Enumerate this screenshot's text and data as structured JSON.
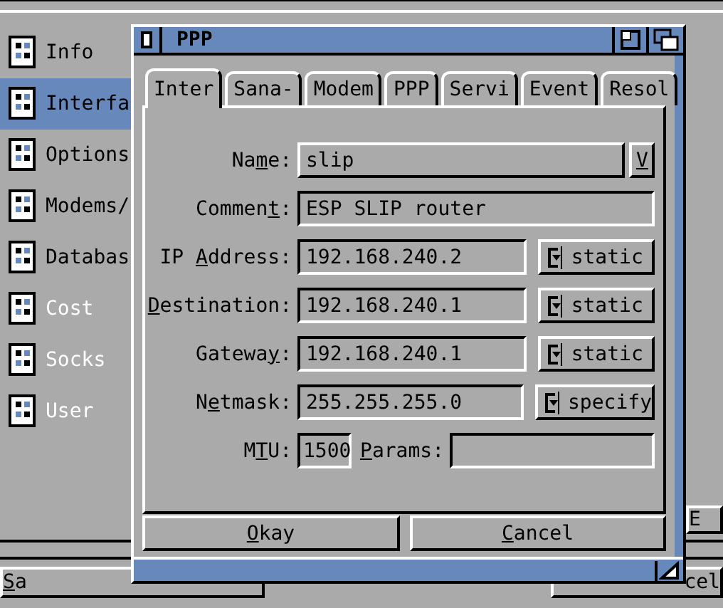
{
  "background": {
    "sidebar": [
      {
        "label": "Info",
        "selected": false,
        "disabled": false
      },
      {
        "label": "Interfa",
        "selected": true,
        "disabled": false
      },
      {
        "label": "Options",
        "selected": false,
        "disabled": false
      },
      {
        "label": "Modems/",
        "selected": false,
        "disabled": false
      },
      {
        "label": "Databas",
        "selected": false,
        "disabled": false
      },
      {
        "label": "Cost",
        "selected": false,
        "disabled": true
      },
      {
        "label": "Socks",
        "selected": false,
        "disabled": true
      },
      {
        "label": "User",
        "selected": false,
        "disabled": true
      }
    ],
    "side_button": "E",
    "save_button": {
      "key": "S",
      "post": "a"
    },
    "cancel_button": {
      "pre": "cel"
    }
  },
  "dialog": {
    "title": "PPP",
    "tabs": [
      {
        "label": "Inter",
        "selected": true
      },
      {
        "label": "Sana-",
        "selected": false
      },
      {
        "label": "Modem",
        "selected": false
      },
      {
        "label": "PPP",
        "selected": false
      },
      {
        "label": "Servi",
        "selected": false
      },
      {
        "label": "Event",
        "selected": false
      },
      {
        "label": "Resol",
        "selected": false
      }
    ],
    "rows": [
      {
        "kind": "dropdown",
        "label": {
          "pre": "Na",
          "key": "m",
          "post": "e:"
        },
        "value": "slip",
        "button": "V"
      },
      {
        "kind": "text",
        "label": {
          "pre": "Commen",
          "key": "t",
          "post": ":"
        },
        "value": "ESP SLIP router"
      },
      {
        "kind": "cycle",
        "label": {
          "pre": "IP ",
          "key": "A",
          "post": "ddress:"
        },
        "value": "192.168.240.2",
        "mode": "static"
      },
      {
        "kind": "cycle",
        "label": {
          "key": "D",
          "post": "estination:"
        },
        "value": "192.168.240.1",
        "mode": "static"
      },
      {
        "kind": "cycle",
        "label": {
          "pre": "Gatewa",
          "key": "y",
          "post": ":"
        },
        "value": "192.168.240.1",
        "mode": "static"
      },
      {
        "kind": "cycle",
        "label": {
          "pre": "N",
          "key": "e",
          "post": "tmask:"
        },
        "value": "255.255.255.0",
        "mode": "specify"
      },
      {
        "kind": "pair",
        "label": {
          "pre": "M",
          "key": "T",
          "post": "U:"
        },
        "value": "1500",
        "label2": {
          "key": "P",
          "post": "arams:"
        }
      }
    ],
    "buttons": [
      {
        "key": "O",
        "post": "kay"
      },
      {
        "key": "C",
        "post": "ancel"
      }
    ]
  }
}
